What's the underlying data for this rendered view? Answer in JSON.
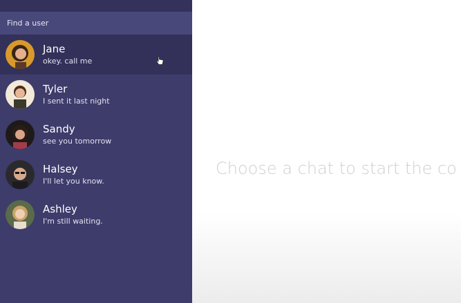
{
  "search": {
    "placeholder": "Find a user"
  },
  "users": [
    {
      "name": "Jane",
      "message": "okey. call me",
      "active": true
    },
    {
      "name": "Tyler",
      "message": "I sent it last night",
      "active": false
    },
    {
      "name": "Sandy",
      "message": "see you tomorrow",
      "active": false
    },
    {
      "name": "Halsey",
      "message": "I'll let you know.",
      "active": false
    },
    {
      "name": "Ashley",
      "message": "I'm still waiting.",
      "active": false
    }
  ],
  "main": {
    "placeholder": "Choose a chat to start the co"
  },
  "colors": {
    "sidebar": "#3e3c6b",
    "search_bar": "#49487a",
    "active_item": "#33315a",
    "placeholder_text": "#cfcfcf"
  }
}
